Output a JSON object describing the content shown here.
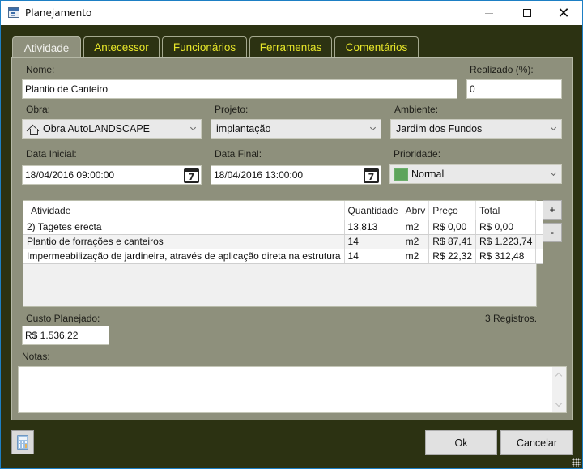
{
  "window": {
    "title": "Planejamento",
    "controls": {
      "minimize": "minimize",
      "maximize": "maximize",
      "close": "close"
    }
  },
  "tabs": [
    {
      "label": "Atividade",
      "active": true
    },
    {
      "label": "Antecessor",
      "active": false
    },
    {
      "label": "Funcionários",
      "active": false
    },
    {
      "label": "Ferramentas",
      "active": false
    },
    {
      "label": "Comentários",
      "active": false
    }
  ],
  "form": {
    "nome": {
      "label": "Nome:",
      "value": "Plantio de Canteiro"
    },
    "realizado": {
      "label": "Realizado (%):",
      "value": "0"
    },
    "obra": {
      "label": "Obra:",
      "value": "Obra AutoLANDSCAPE",
      "icon": "house-icon"
    },
    "projeto": {
      "label": "Projeto:",
      "value": "implantação"
    },
    "ambiente": {
      "label": "Ambiente:",
      "value": "Jardim dos Fundos"
    },
    "data_inicial": {
      "label": "Data Inicial:",
      "value": "18/04/2016 09:00:00",
      "icon_day": "7"
    },
    "data_final": {
      "label": "Data Final:",
      "value": "18/04/2016 13:00:00",
      "icon_day": "7"
    },
    "prioridade": {
      "label": "Prioridade:",
      "value": "Normal",
      "color": "#5da45c"
    }
  },
  "grid": {
    "columns": [
      "Atividade",
      "Quantidade",
      "Abrv",
      "Preço",
      "Total"
    ],
    "rows": [
      [
        "2) Tagetes erecta",
        "13,813",
        "m2",
        "R$ 0,00",
        "R$ 0,00"
      ],
      [
        "Plantio de forrações e canteiros",
        "14",
        "m2",
        "R$ 87,41",
        "R$ 1.223,74"
      ],
      [
        "Impermeabilização de jardineira, através de aplicação direta na estrutura",
        "14",
        "m2",
        "R$ 22,32",
        "R$ 312,48"
      ]
    ],
    "add_label": "+",
    "remove_label": "-"
  },
  "custo": {
    "label": "Custo Planejado:",
    "value": "R$ 1.536,22"
  },
  "registros": "3 Registros.",
  "notas": {
    "label": "Notas:",
    "value": ""
  },
  "footer": {
    "ok_label": "Ok",
    "cancel_label": "Cancelar"
  }
}
